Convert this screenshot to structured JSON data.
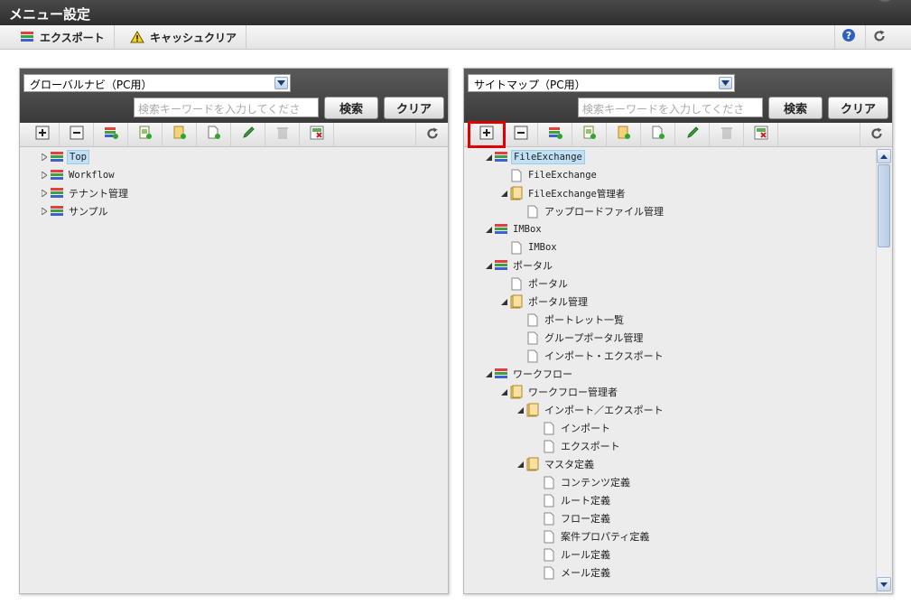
{
  "title": "メニュー設定",
  "toolbar": {
    "export_label": "エクスポート",
    "cache_clear_label": "キャッシュクリア"
  },
  "left": {
    "select_value": "グローバルナビ（PC用）",
    "search_placeholder": "検索キーワードを入力してくださ",
    "search_button": "検索",
    "clear_button": "クリア",
    "tree": [
      {
        "label": "Top",
        "selected": true
      },
      {
        "label": "Workflow"
      },
      {
        "label": "テナント管理"
      },
      {
        "label": "サンプル"
      }
    ]
  },
  "right": {
    "select_value": "サイトマップ（PC用）",
    "search_placeholder": "検索キーワードを入力してくださ",
    "search_button": "検索",
    "clear_button": "クリア",
    "tree": [
      {
        "label": "FileExchange",
        "selected": true
      },
      {
        "label": "FileExchange"
      },
      {
        "label": "FileExchange管理者"
      },
      {
        "label": "アップロードファイル管理"
      },
      {
        "label": "IMBox"
      },
      {
        "label": "IMBox"
      },
      {
        "label": "ポータル"
      },
      {
        "label": "ポータル"
      },
      {
        "label": "ポータル管理"
      },
      {
        "label": "ポートレット一覧"
      },
      {
        "label": "グループポータル管理"
      },
      {
        "label": "インポート・エクスポート"
      },
      {
        "label": "ワークフロー"
      },
      {
        "label": "ワークフロー管理者"
      },
      {
        "label": "インポート／エクスポート"
      },
      {
        "label": "インポート"
      },
      {
        "label": "エクスポート"
      },
      {
        "label": "マスタ定義"
      },
      {
        "label": "コンテンツ定義"
      },
      {
        "label": "ルート定義"
      },
      {
        "label": "フロー定義"
      },
      {
        "label": "案件プロパティ定義"
      },
      {
        "label": "ルール定義"
      },
      {
        "label": "メール定義"
      }
    ]
  },
  "icons": [
    "export-icon",
    "warning-icon",
    "help-icon",
    "refresh-icon",
    "expand-all-icon",
    "collapse-all-icon",
    "add-menu-icon",
    "add-page-icon",
    "add-folder-icon",
    "add-item-icon",
    "edit-icon",
    "delete-icon",
    "cancel-icon",
    "menu-icon",
    "folder-icon",
    "page-icon"
  ],
  "colors": {
    "highlight": "#e00000",
    "selected_bg": "#bfe0f5",
    "header_bg": "#3a3a3a"
  }
}
